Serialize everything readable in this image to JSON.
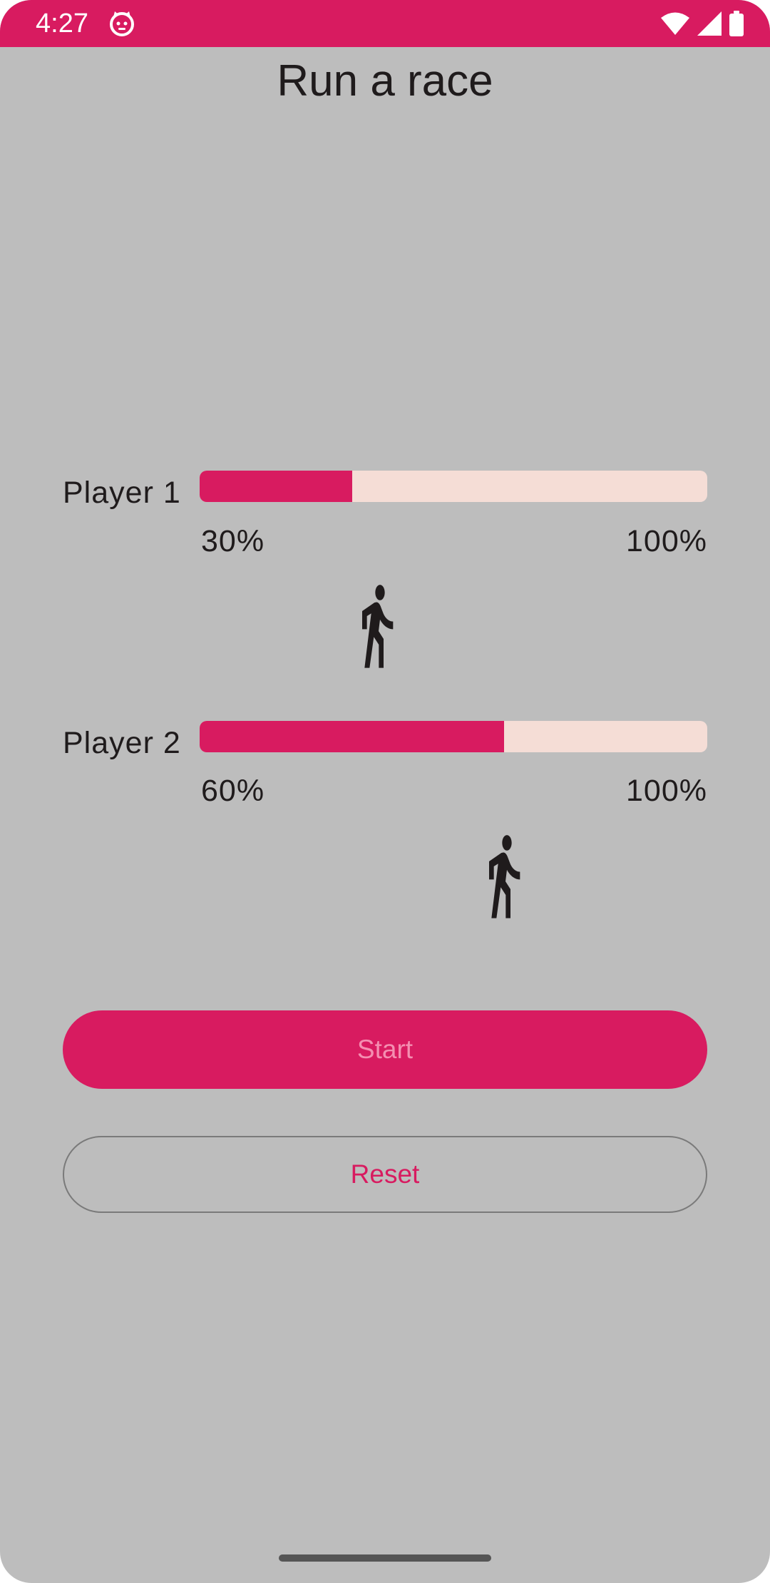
{
  "status_bar": {
    "time": "4:27",
    "app_icon": "android-cat-icon",
    "icons": [
      "wifi-icon",
      "cellular-signal-icon",
      "battery-icon"
    ],
    "color": "#d81b60"
  },
  "title": "Run a race",
  "players": [
    {
      "label": "Player 1",
      "progress_label": "30%",
      "max_label": "100%",
      "progress": 0.3,
      "icon": "walking-person-icon"
    },
    {
      "label": "Player 2",
      "progress_label": "60%",
      "max_label": "100%",
      "progress": 0.6,
      "icon": "walking-person-icon"
    }
  ],
  "buttons": {
    "start_label": "Start",
    "reset_label": "Reset"
  },
  "colors": {
    "accent": "#d81b60",
    "track": "#f5ddd6",
    "background": "#bdbdbd",
    "start_text": "#f48fb1"
  }
}
